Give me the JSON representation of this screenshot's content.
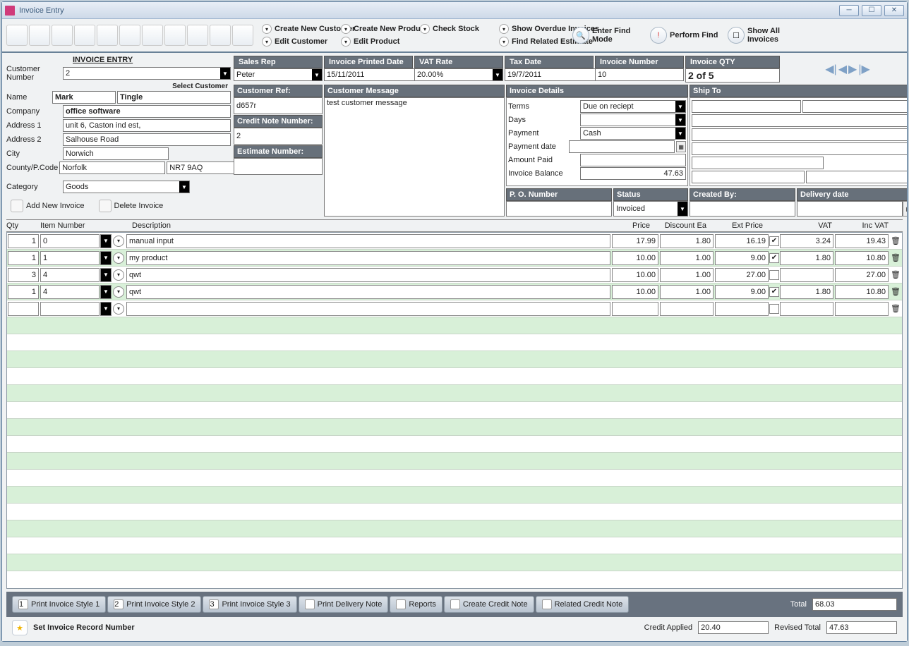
{
  "window": {
    "title": "Invoice Entry"
  },
  "toolbar": {
    "links": {
      "create_customer": "Create New Customer",
      "edit_customer": "Edit Customer",
      "create_product": "Create New Product",
      "edit_product": "Edit Product",
      "check_stock": "Check Stock",
      "overdue": "Show Overdue Invoices",
      "find_estimate": "Find Related Estimate",
      "find_mode": "Enter Find Mode",
      "perform_find": "Perform Find",
      "show_all": "Show All Invoices"
    }
  },
  "left": {
    "title": "INVOICE ENTRY",
    "customer_number_lbl": "Customer Number",
    "customer_number": "2",
    "select_customer": "Select Customer",
    "name_lbl": "Name",
    "first": "Mark",
    "last": "Tingle",
    "company_lbl": "Company",
    "company": "office software",
    "addr1_lbl": "Address 1",
    "addr1": "unit 6, Caston ind est,",
    "addr2_lbl": "Address 2",
    "addr2": "Salhouse Road",
    "city_lbl": "City",
    "city": "Norwich",
    "county_lbl": "County/P.Code",
    "county": "Norfolk",
    "pcode": "NR7 9AQ",
    "category_lbl": "Category",
    "category": "Goods",
    "add_invoice": "Add New Invoice",
    "delete_invoice": "Delete Invoice"
  },
  "hdrs": {
    "sales_rep": "Sales Rep",
    "printed_date": "Invoice Printed  Date",
    "vat_rate": "VAT Rate",
    "tax_date": "Tax Date",
    "invoice_no": "Invoice Number",
    "invoice_qty": "Invoice QTY",
    "cust_ref": "Customer Ref:",
    "credit_note": "Credit Note Number:",
    "estimate": "Estimate Number:",
    "cust_msg": "Customer Message",
    "inv_details": "Invoice Details",
    "po": "P. O.  Number",
    "status": "Status",
    "created": "Created By:",
    "delivery": "Delivery date",
    "ship": "Ship To"
  },
  "vals": {
    "sales_rep": "Peter",
    "printed_date": "15/11/2011",
    "vat_rate": "20.00%",
    "tax_date": "19/7/2011",
    "invoice_no": "10",
    "invoice_qty": "2 of 5",
    "cust_ref": "d657r",
    "credit_note": "2",
    "estimate": "",
    "cust_msg": "test customer message"
  },
  "details": {
    "terms_lbl": "Terms",
    "terms": "Due on reciept",
    "days_lbl": "Days",
    "days": "",
    "payment_lbl": "Payment",
    "payment": "Cash",
    "payment_date_lbl": "Payment date",
    "payment_date": "",
    "amount_lbl": "Amount Paid",
    "amount": "",
    "balance_lbl": "Invoice Balance",
    "balance": "47.63",
    "status": "Invoiced"
  },
  "cols": {
    "qty": "Qty",
    "item": "Item Number",
    "desc": "Description",
    "price": "Price",
    "disc": "Discount Ea",
    "ext": "Ext Price",
    "vat": "VAT",
    "inc": "Inc VAT"
  },
  "lines": [
    {
      "qty": "1",
      "item": "0",
      "desc": "manual input",
      "price": "17.99",
      "disc": "1.80",
      "ext": "16.19",
      "chk": true,
      "vat": "3.24",
      "inc": "19.43"
    },
    {
      "qty": "1",
      "item": "1",
      "desc": "my product",
      "price": "10.00",
      "disc": "1.00",
      "ext": "9.00",
      "chk": true,
      "vat": "1.80",
      "inc": "10.80"
    },
    {
      "qty": "3",
      "item": "4",
      "desc": "qwt",
      "price": "10.00",
      "disc": "1.00",
      "ext": "27.00",
      "chk": false,
      "vat": "",
      "inc": "27.00"
    },
    {
      "qty": "1",
      "item": "4",
      "desc": "qwt",
      "price": "10.00",
      "disc": "1.00",
      "ext": "9.00",
      "chk": true,
      "vat": "1.80",
      "inc": "10.80"
    }
  ],
  "footer": {
    "s1": "Print Invoice Style 1",
    "s2": "Print Invoice Style 2",
    "s3": "Print Invoice Style 3",
    "delivery": "Print Delivery Note",
    "reports": "Reports",
    "credit": "Create Credit Note",
    "related": "Related Credit Note",
    "total_lbl": "Total",
    "total": "68.03"
  },
  "sub": {
    "set_record": "Set Invoice Record Number",
    "credit_lbl": "Credit  Applied",
    "credit": "20.40",
    "revised_lbl": "Revised Total",
    "revised": "47.63"
  }
}
